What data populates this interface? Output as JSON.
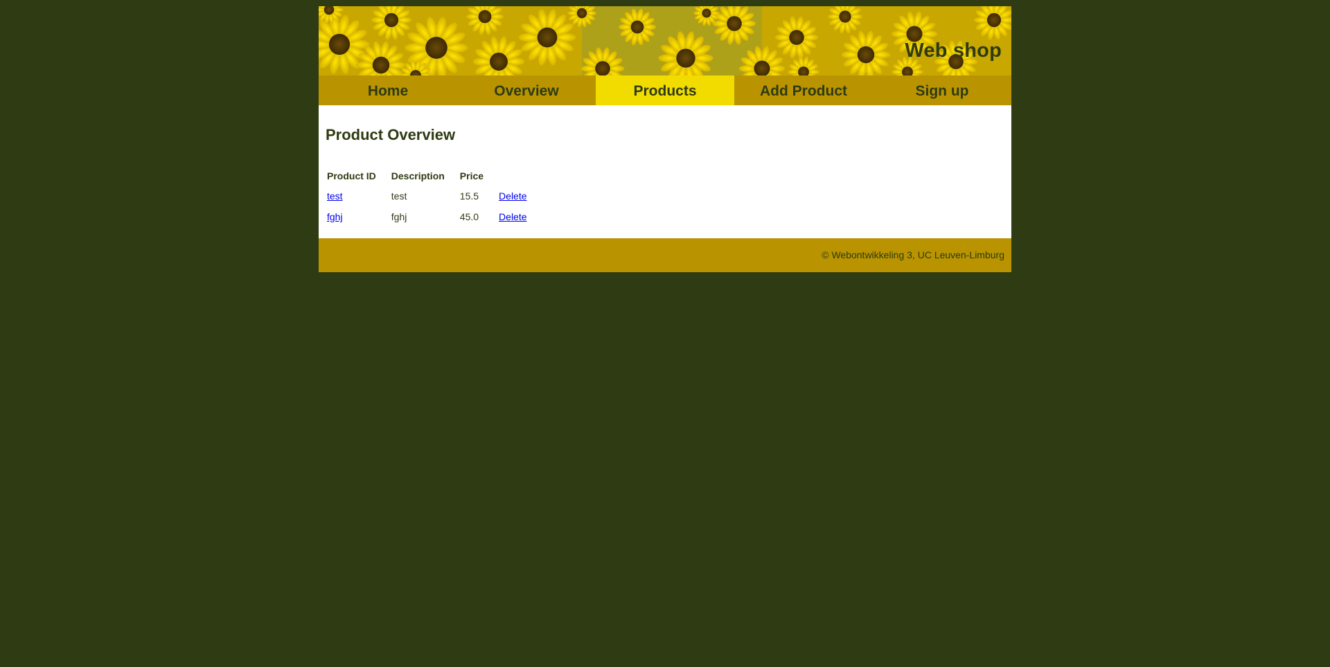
{
  "header": {
    "site_title": "Web shop"
  },
  "nav": {
    "items": [
      {
        "label": "Home"
      },
      {
        "label": "Overview"
      },
      {
        "label": "Products"
      },
      {
        "label": "Add Product"
      },
      {
        "label": "Sign up"
      }
    ],
    "active_label": "Products"
  },
  "main": {
    "page_title": "Product Overview",
    "table": {
      "columns": [
        "Product ID",
        "Description",
        "Price"
      ],
      "rows": [
        {
          "id": "test",
          "description": "test",
          "price": "15.5",
          "action": "Delete"
        },
        {
          "id": "fghj",
          "description": "fghj",
          "price": "45.0",
          "action": "Delete"
        }
      ]
    }
  },
  "footer": {
    "copyright": "© Webontwikkeling 3, UC Leuven-Limburg"
  },
  "colors": {
    "page_background": "#2f3b12",
    "nav_background": "#b99400",
    "nav_active": "#f2dc00",
    "text": "#2e3a12",
    "link": "#0000ee"
  }
}
